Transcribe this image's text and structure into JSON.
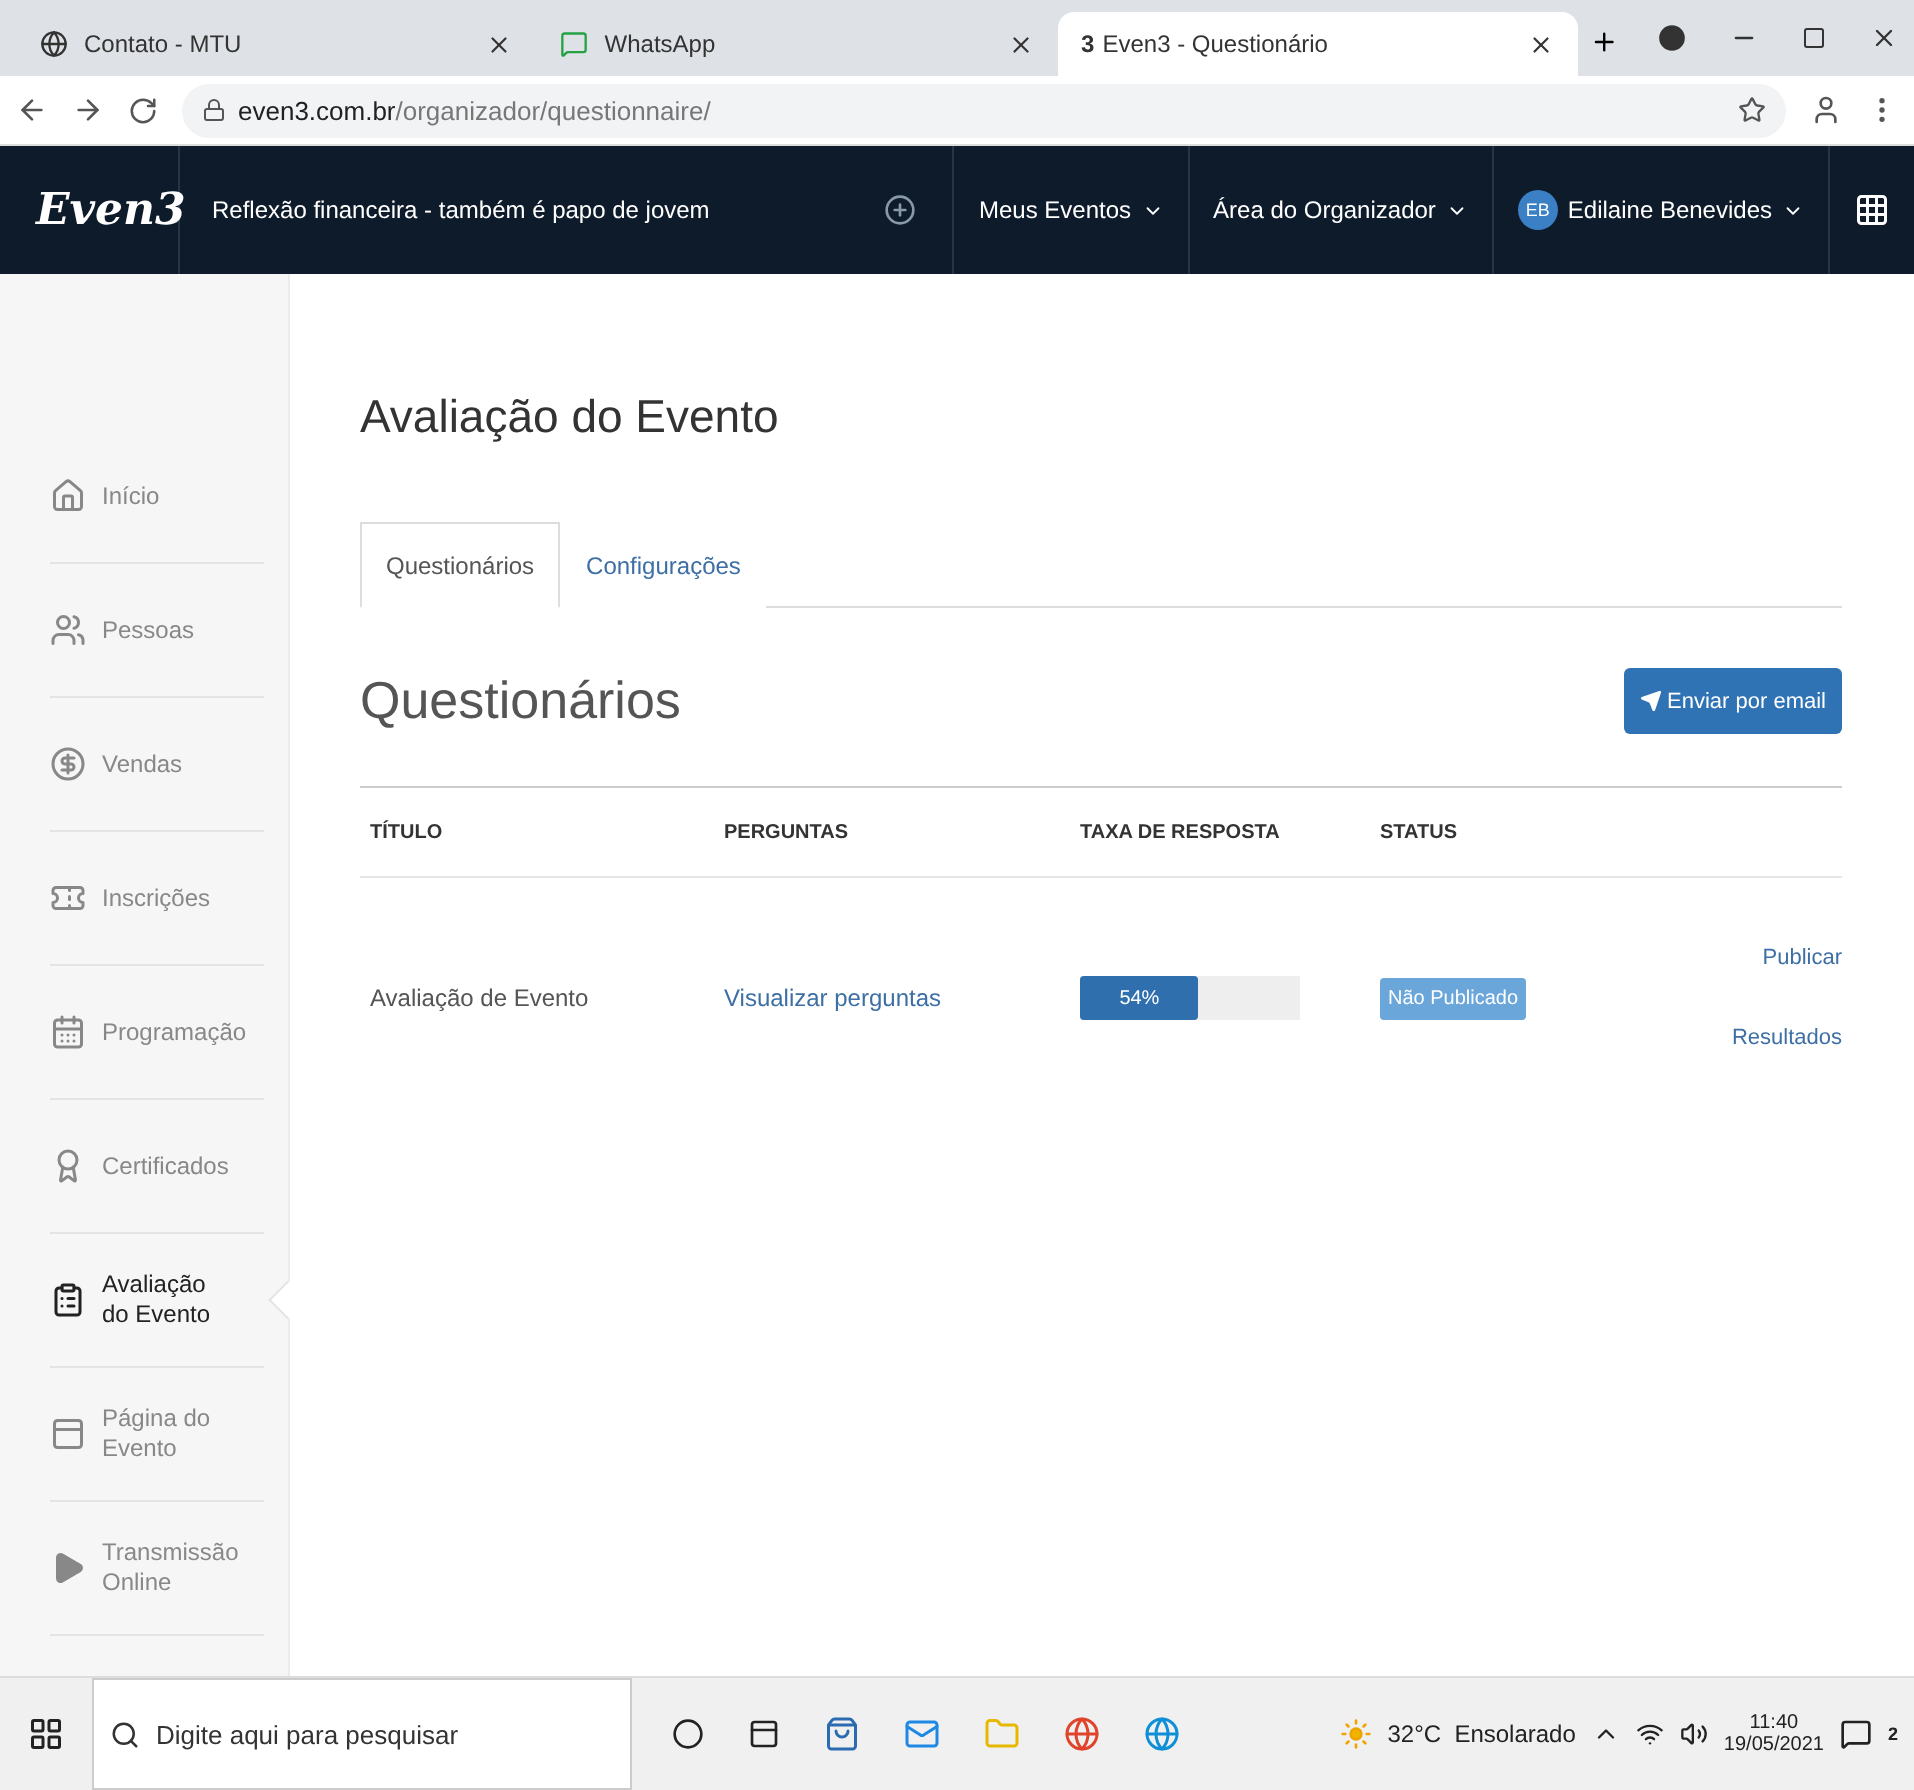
{
  "browser": {
    "tabs": [
      {
        "title": "Contato - MTU",
        "selected": false
      },
      {
        "title": "WhatsApp",
        "selected": false
      },
      {
        "count": "3",
        "title": "Even3 - Questionário",
        "selected": true
      }
    ],
    "url_host": "even3.com.br",
    "url_path": "/organizador/questionnaire/"
  },
  "header": {
    "logo": "Even3",
    "event_name": "Reflexão financeira - também é papo de jovem",
    "menus": [
      "Meus Eventos",
      "Área do Organizador"
    ],
    "user": {
      "initials": "EB",
      "name": "Edilaine Benevides"
    }
  },
  "sidebar": {
    "items": [
      {
        "kind": "home",
        "label": "Início",
        "selected": false
      },
      {
        "kind": "people",
        "label": "Pessoas",
        "selected": false
      },
      {
        "kind": "sales",
        "label": "Vendas",
        "selected": false
      },
      {
        "kind": "tickets",
        "label": "Inscrições",
        "selected": false
      },
      {
        "kind": "schedule",
        "label": "Programação",
        "selected": false
      },
      {
        "kind": "certificate",
        "label": "Certificados",
        "selected": false
      },
      {
        "kind": "survey",
        "label": "Avaliação\ndo Evento",
        "selected": true
      },
      {
        "kind": "page",
        "label": "Página do\nEvento",
        "selected": false
      },
      {
        "kind": "stream",
        "label": "Transmissão\nOnline",
        "selected": false
      }
    ]
  },
  "page": {
    "title": "Avaliação do Evento",
    "tabs": [
      {
        "label": "Questionários",
        "selected": true
      },
      {
        "label": "Configurações",
        "selected": false
      }
    ],
    "section_title": "Questionários",
    "send_button": "Enviar por email",
    "table": {
      "columns": [
        "TÍTULO",
        "PERGUNTAS",
        "TAXA DE RESPOSTA",
        "STATUS"
      ],
      "rows": [
        {
          "title": "Avaliação de Evento",
          "questions_link": "Visualizar perguntas",
          "rate": {
            "level": 0.54,
            "label": "54%"
          },
          "status": "Não Publicado",
          "actions": [
            "Publicar",
            "Resultados"
          ]
        }
      ]
    }
  },
  "taskbar": {
    "search_placeholder": "Digite aqui para pesquisar",
    "weather": "32°C  Ensolarado",
    "time": "11:40",
    "date": "19/05/2021",
    "notifications": "2"
  }
}
